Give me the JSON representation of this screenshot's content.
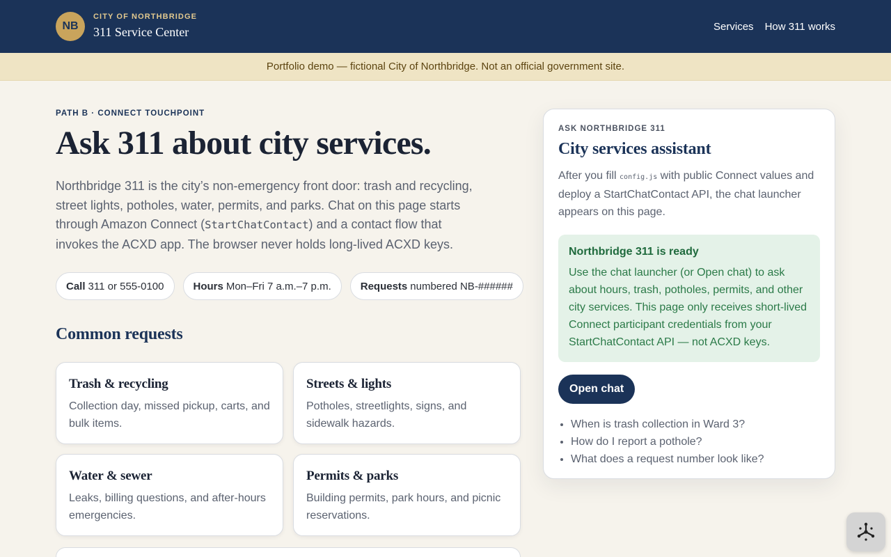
{
  "header": {
    "seal_text": "NB",
    "eyebrow": "CITY OF NORTHBRIDGE",
    "title": "311 Service Center",
    "nav": [
      {
        "label": "Services"
      },
      {
        "label": "How 311 works"
      }
    ]
  },
  "banner": {
    "text": "Portfolio demo — fictional City of Northbridge. Not an official government site."
  },
  "hero": {
    "eyebrow": "PATH B · CONNECT TOUCHPOINT",
    "title": "Ask 311 about city services.",
    "lede_part1": "Northbridge 311 is the city’s non-emergency front door: trash and recycling, street lights, potholes, water, permits, and parks. Chat on this page starts through Amazon Connect (",
    "lede_code": "StartChatContact",
    "lede_part2": ") and a contact flow that invokes the ACXD app. The browser never holds long-lived ACXD keys."
  },
  "chips": [
    {
      "label": "Call",
      "value": "311 or 555-0100"
    },
    {
      "label": "Hours",
      "value": "Mon–Fri 7 a.m.–7 p.m."
    },
    {
      "label": "Requests",
      "value": "numbered NB-######"
    }
  ],
  "common": {
    "heading": "Common requests",
    "cards": [
      {
        "title": "Trash & recycling",
        "desc": "Collection day, missed pickup, carts, and bulk items."
      },
      {
        "title": "Streets & lights",
        "desc": "Potholes, streetlights, signs, and sidewalk hazards."
      },
      {
        "title": "Water & sewer",
        "desc": "Leaks, billing questions, and after-hours emergencies."
      },
      {
        "title": "Permits & parks",
        "desc": "Building permits, park hours, and picnic reservations."
      }
    ]
  },
  "assistant": {
    "eyebrow": "ASK NORTHBRIDGE 311",
    "title": "City services assistant",
    "desc_part1": "After you fill ",
    "desc_code": "config.js",
    "desc_part2": " with public Connect values and deploy a StartChatContact API, the chat launcher appears on this page.",
    "ready_title": "Northbridge 311 is ready",
    "ready_text": "Use the chat launcher (or Open chat) to ask about hours, trash, potholes, permits, and other city services. This page only receives short-lived Connect participant credentials from your StartChatContact API — not ACXD keys.",
    "open_chat": "Open chat",
    "suggestions": [
      "When is trash collection in Ward 3?",
      "How do I report a pothole?",
      "What does a request number look like?"
    ]
  },
  "launcher": {
    "icon": "chat-launcher-icon"
  },
  "colors": {
    "header_bg": "#1b3358",
    "seal_gold": "#c9a45c",
    "banner_bg": "#efe4c4",
    "page_bg": "#f6f3ec",
    "ready_bg": "#e4f2e8",
    "ready_text": "#1f6a3d"
  }
}
